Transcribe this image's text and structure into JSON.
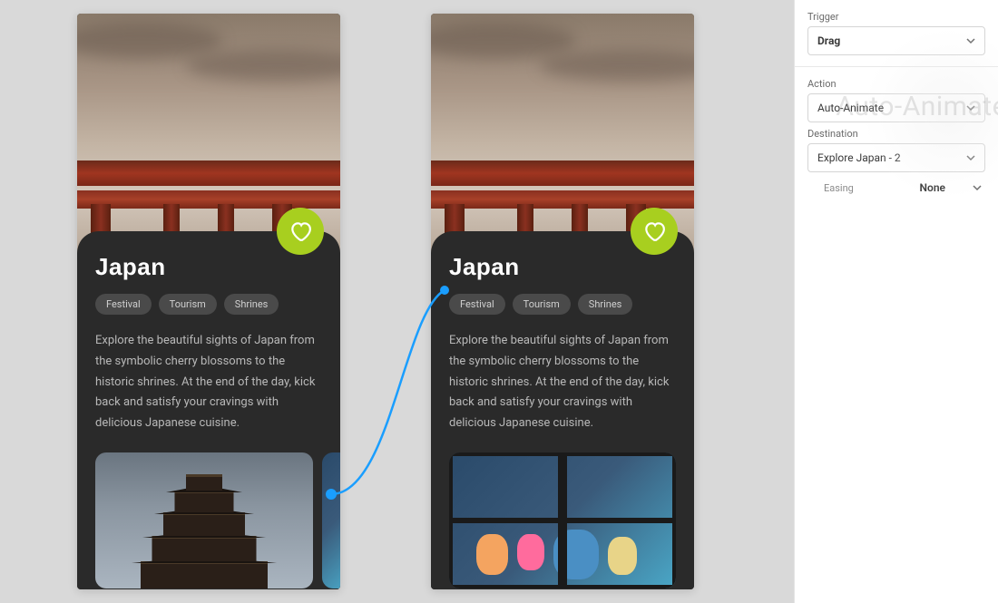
{
  "artboards": {
    "card": {
      "title": "Japan",
      "tags": [
        "Festival",
        "Tourism",
        "Shrines"
      ],
      "description": "Explore the beautiful sights of Japan from the symbolic cherry blossoms to the historic shrines. At the end of the day, kick back and satisfy your cravings with delicious Japanese cuisine."
    }
  },
  "panel": {
    "trigger": {
      "label": "Trigger",
      "value": "Drag"
    },
    "action": {
      "label": "Action",
      "value": "Auto-Animate"
    },
    "destination": {
      "label": "Destination",
      "value": "Explore Japan - 2"
    },
    "easing": {
      "label": "Easing",
      "value": "None"
    },
    "watermark": "Auto-Animate"
  },
  "colors": {
    "accent": "#a8cf1f",
    "connector": "#1a9eff"
  }
}
